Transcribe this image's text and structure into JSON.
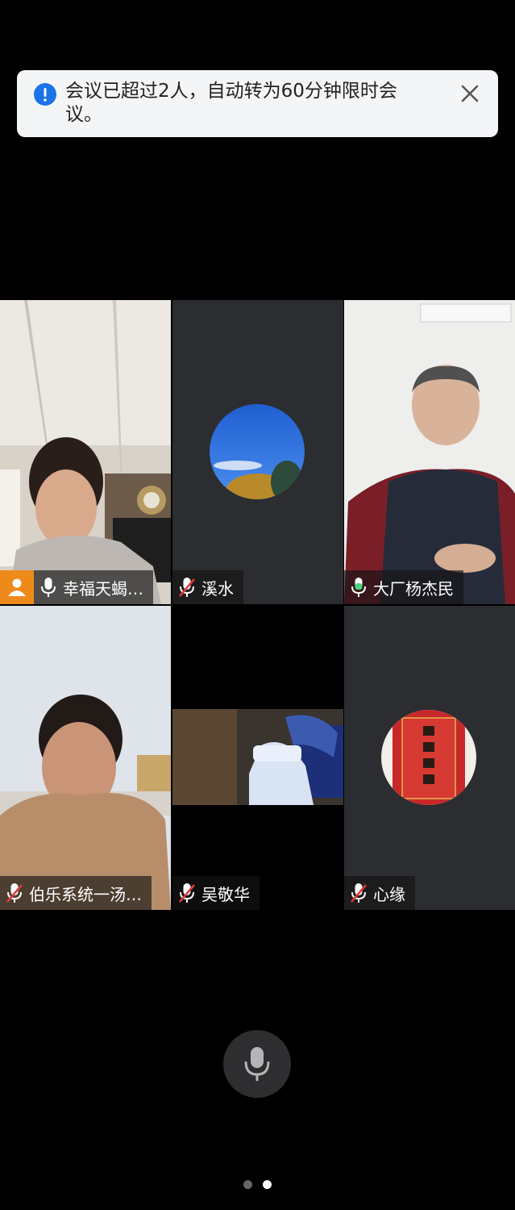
{
  "notification": {
    "message": "会议已超过2人，自动转为60分钟限时会议。",
    "icon": "info-icon",
    "close_icon": "close-icon"
  },
  "participants": [
    {
      "name": "幸福天蝎…",
      "mic": "on",
      "host": true,
      "video": true
    },
    {
      "name": "溪水",
      "mic": "muted",
      "host": false,
      "video": false
    },
    {
      "name": "大厂杨杰民",
      "mic": "speaking",
      "host": false,
      "video": true,
      "active": true
    },
    {
      "name": "伯乐系统一汤…",
      "mic": "muted",
      "host": false,
      "video": true
    },
    {
      "name": "吴敬华",
      "mic": "muted",
      "host": false,
      "video": true
    },
    {
      "name": "心缘",
      "mic": "muted",
      "host": false,
      "video": false
    }
  ],
  "controls": {
    "mic_button": "microphone-icon"
  },
  "pager": {
    "pages": 2,
    "current": 2
  },
  "colors": {
    "accent": "#1a73e8",
    "speaking": "#4cd17f",
    "muted": "#e03a3a",
    "host_badge": "#ee8a1a"
  }
}
